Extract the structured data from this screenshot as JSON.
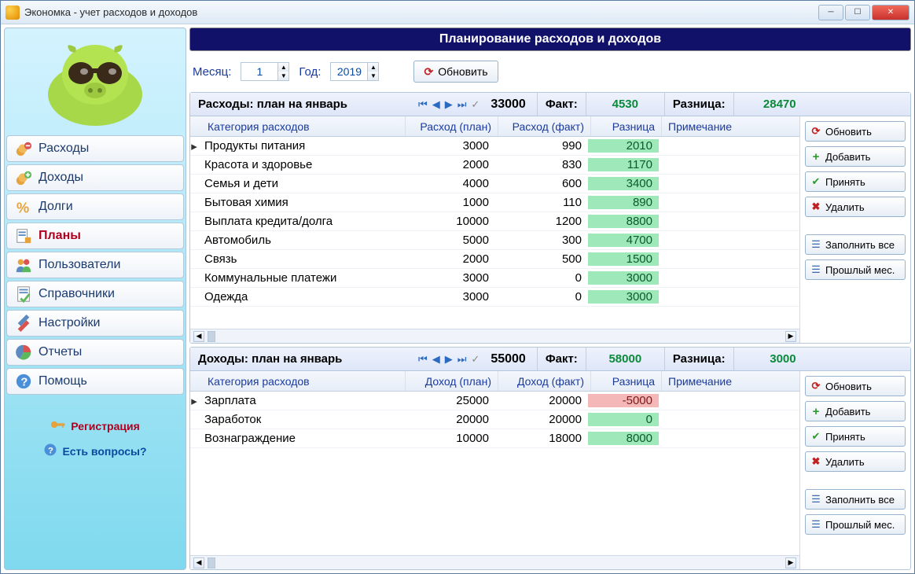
{
  "title": "Экономка - учет расходов и доходов",
  "sidebar": {
    "items": [
      {
        "label": "Расходы"
      },
      {
        "label": "Доходы"
      },
      {
        "label": "Долги"
      },
      {
        "label": "Планы"
      },
      {
        "label": "Пользователи"
      },
      {
        "label": "Справочники"
      },
      {
        "label": "Настройки"
      },
      {
        "label": "Отчеты"
      },
      {
        "label": "Помощь"
      }
    ],
    "register": "Регистрация",
    "questions": "Есть вопросы?"
  },
  "banner": "Планирование расходов и доходов",
  "controls": {
    "month_label": "Месяц:",
    "month_value": "1",
    "year_label": "Год:",
    "year_value": "2019",
    "refresh": "Обновить"
  },
  "expense": {
    "title": "Расходы: план на январь",
    "total": "33000",
    "fact_label": "Факт:",
    "fact_value": "4530",
    "diff_label": "Разница:",
    "diff_value": "28470",
    "headers": {
      "cat": "Категория расходов",
      "plan": "Расход (план)",
      "fact": "Расход (факт)",
      "diff": "Разница",
      "note": "Примечание"
    },
    "rows": [
      {
        "cat": "Продукты питания",
        "plan": "3000",
        "fact": "990",
        "diff": "2010"
      },
      {
        "cat": "Красота и здоровье",
        "plan": "2000",
        "fact": "830",
        "diff": "1170"
      },
      {
        "cat": "Семья и дети",
        "plan": "4000",
        "fact": "600",
        "diff": "3400"
      },
      {
        "cat": "Бытовая химия",
        "plan": "1000",
        "fact": "110",
        "diff": "890"
      },
      {
        "cat": "Выплата кредита/долга",
        "plan": "10000",
        "fact": "1200",
        "diff": "8800"
      },
      {
        "cat": "Автомобиль",
        "plan": "5000",
        "fact": "300",
        "diff": "4700"
      },
      {
        "cat": "Связь",
        "plan": "2000",
        "fact": "500",
        "diff": "1500"
      },
      {
        "cat": "Коммунальные платежи",
        "plan": "3000",
        "fact": "0",
        "diff": "3000"
      },
      {
        "cat": "Одежда",
        "plan": "3000",
        "fact": "0",
        "diff": "3000"
      }
    ]
  },
  "income": {
    "title": "Доходы: план на январь",
    "total": "55000",
    "fact_label": "Факт:",
    "fact_value": "58000",
    "diff_label": "Разница:",
    "diff_value": "3000",
    "headers": {
      "cat": "Категория расходов",
      "plan": "Доход (план)",
      "fact": "Доход (факт)",
      "diff": "Разница",
      "note": "Примечание"
    },
    "rows": [
      {
        "cat": "Зарплата",
        "plan": "25000",
        "fact": "20000",
        "diff": "-5000",
        "neg": true
      },
      {
        "cat": "Заработок",
        "plan": "20000",
        "fact": "20000",
        "diff": "0"
      },
      {
        "cat": "Вознаграждение",
        "plan": "10000",
        "fact": "18000",
        "diff": "8000"
      }
    ]
  },
  "side_buttons": {
    "refresh": "Обновить",
    "add": "Добавить",
    "accept": "Принять",
    "delete": "Удалить",
    "fill_all": "Заполнить все",
    "prev_month": "Прошлый мес."
  }
}
